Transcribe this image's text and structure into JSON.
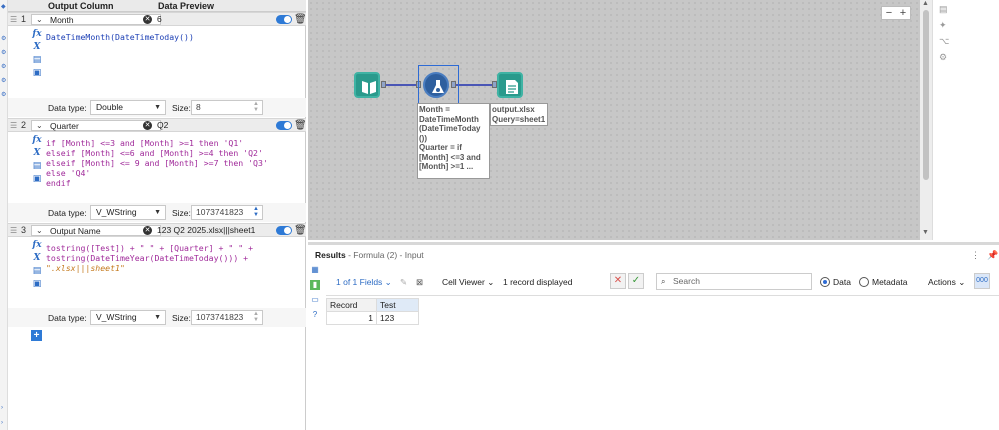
{
  "formula_panel": {
    "header": {
      "output_column": "Output Column",
      "data_preview": "Data Preview"
    },
    "rows": [
      {
        "num": "1",
        "column": "Month",
        "preview": "6",
        "code": [
          "DateTimeMonth(DateTimeToday())"
        ],
        "data_type_label": "Data type:",
        "data_type": "Double",
        "size_label": "Size:",
        "size": "8"
      },
      {
        "num": "2",
        "column": "Quarter",
        "preview": "Q2",
        "code": [
          "if [Month] <=3 and [Month] >=1 then 'Q1'",
          "elseif [Month] <=6 and [Month] >=4 then 'Q2'",
          "elseif [Month] <= 9 and [Month] >=7 then 'Q3'",
          "else 'Q4'",
          "endif"
        ],
        "data_type_label": "Data type:",
        "data_type": "V_WString",
        "size_label": "Size:",
        "size": "1073741823"
      },
      {
        "num": "3",
        "column": "Output Name",
        "preview": "123 Q2 2025.xlsx|||sheet1",
        "code": [
          "tostring([Test]) + \" \" + [Quarter] + \" \" +",
          "tostring(DateTimeYear(DateTimeToday())) +",
          "\".xlsx|||sheet1\""
        ],
        "data_type_label": "Data type:",
        "data_type": "V_WString",
        "size_label": "Size:",
        "size": "1073741823"
      }
    ],
    "add_label": "+"
  },
  "canvas": {
    "zoom_out": "−",
    "zoom_in": "+",
    "formula_annotation": "Month =\nDateTimeMonth\n(DateTimeToday\n())\nQuarter = if\n[Month] <=3 and\n[Month] >=1 ...",
    "output_annotation": "output.xlsx\nQuery=sheet1"
  },
  "results": {
    "title_bold": "Results",
    "title_rest": " - Formula (2) - Input",
    "fields": "1 of 1 Fields",
    "viewer": "Cell Viewer",
    "records_displayed": "1 record displayed",
    "search_placeholder": "Search",
    "data_label": "Data",
    "metadata_label": "Metadata",
    "actions_label": "Actions",
    "columns": [
      "Record",
      "Test"
    ],
    "rows": [
      [
        "1",
        "123"
      ]
    ]
  }
}
